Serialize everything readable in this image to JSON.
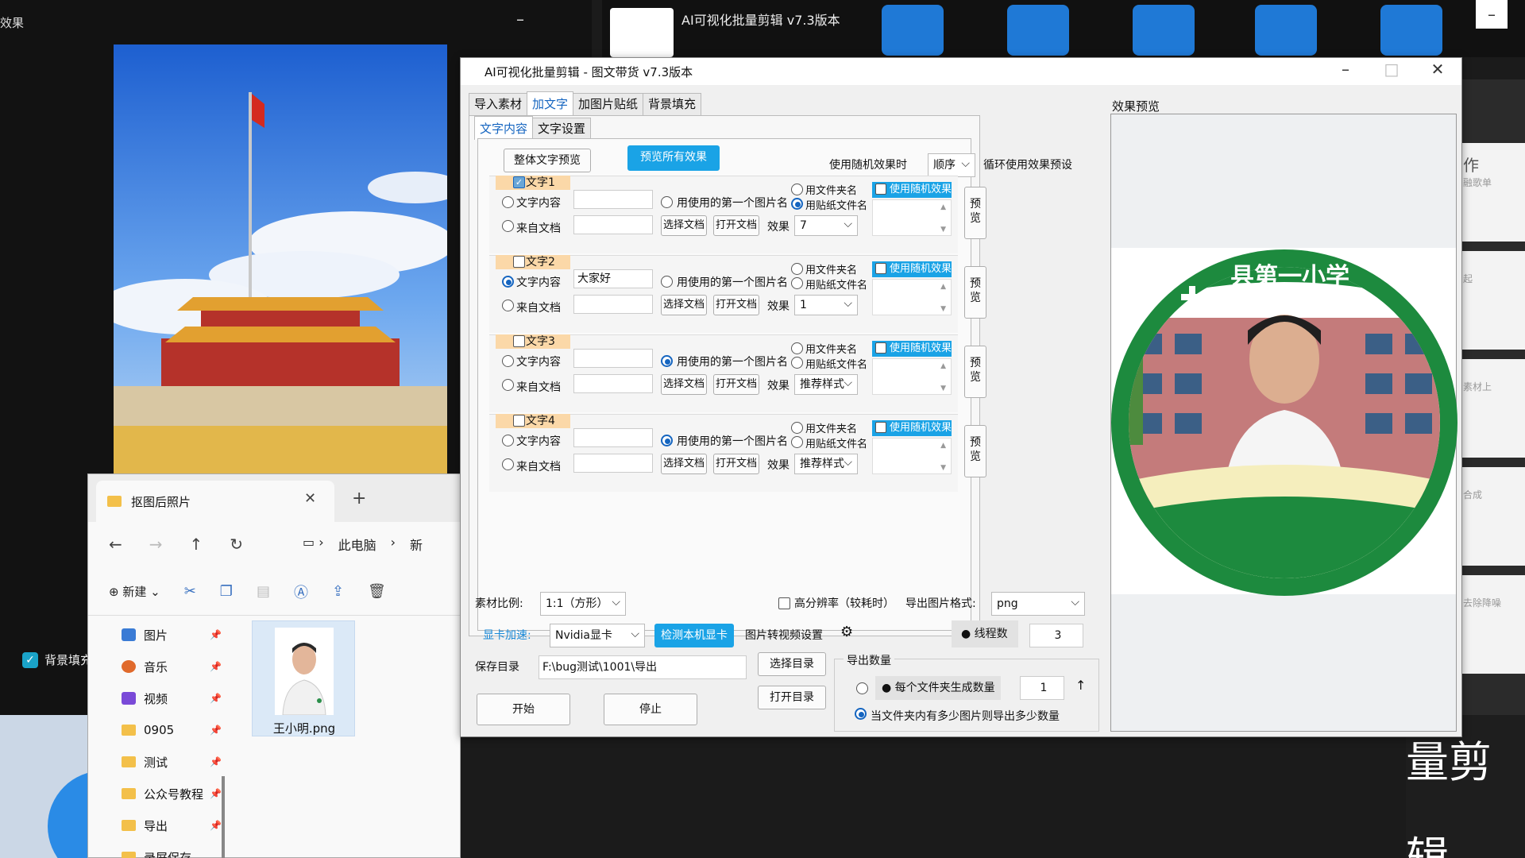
{
  "left_app": {
    "title": "效果",
    "min": "–",
    "bg_checkbox": "背景填充"
  },
  "top_app": {
    "title": "AI可视化批量剪辑 v7.3版本",
    "icon_names": [
      "video-clapper-icon",
      "add-list-icon",
      "sliders-icon",
      "export-icon",
      "grid-icon"
    ],
    "close": "–"
  },
  "right_app": {
    "cards": [
      "作",
      "融歌单",
      "起",
      "素材上",
      "合成",
      "去除降噪"
    ],
    "big_label": "量剪辑"
  },
  "explorer": {
    "tab_title": "抠图后照片",
    "close": "✕",
    "plus": "+",
    "nav": {
      "back": "←",
      "forward": "→",
      "up": "↑",
      "refresh": "↻"
    },
    "breadcrumb": [
      "此电脑",
      "新"
    ],
    "new_label": "新建",
    "sidebar": [
      {
        "label": "图片",
        "color": "#3a7bd5"
      },
      {
        "label": "音乐",
        "color": "#e06a2c"
      },
      {
        "label": "视频",
        "color": "#7a4ad8"
      },
      {
        "label": "0905",
        "color": "#f3c04a"
      },
      {
        "label": "测试",
        "color": "#f3c04a"
      },
      {
        "label": "公众号教程",
        "color": "#f3c04a"
      },
      {
        "label": "导出",
        "color": "#f3c04a"
      },
      {
        "label": "录屏保存",
        "color": "#f3c04a"
      }
    ],
    "file_name": "王小明.png"
  },
  "dialog": {
    "title": "AI可视化批量剪辑 - 图文带货 v7.3版本",
    "controls": {
      "minimize": "–",
      "maximize": "□",
      "close": "✕"
    },
    "main_tabs": [
      "导入素材",
      "加文字",
      "加图片贴纸",
      "背景填充"
    ],
    "sub_tabs": [
      "文字内容",
      "文字设置"
    ],
    "whole_preview": "整体文字预览",
    "preview_all": "预览所有效果",
    "random_mode_label": "使用随机效果时",
    "random_mode_value": "顺序",
    "loop_label": "循环使用效果预设",
    "groups": [
      {
        "title": "加文字1",
        "checked": true,
        "text_value": "",
        "src": "none",
        "name_mode": "sticker",
        "effect": "7"
      },
      {
        "title": "加文字2",
        "checked": false,
        "text_value": "大家好",
        "src": "text",
        "name_mode": "none",
        "effect": "1"
      },
      {
        "title": "加文字3",
        "checked": false,
        "text_value": "",
        "src": "first",
        "name_mode": "none",
        "effect": "推荐样式"
      },
      {
        "title": "加文字4",
        "checked": false,
        "text_value": "",
        "src": "first",
        "name_mode": "none",
        "effect": "推荐样式"
      }
    ],
    "labels": {
      "text_content": "文字内容",
      "from_doc": "来自文档",
      "first_image_name": "用使用的第一个图片名",
      "folder_name": "用文件夹名",
      "sticker_name": "用贴纸文件名",
      "choose_doc": "选择文档",
      "open_doc": "打开文档",
      "effect": "效果",
      "use_random": "使用随机效果",
      "preview": "预览"
    },
    "bottom": {
      "ratio_label": "素材比例:",
      "ratio_value": "1:1（方形）",
      "hires_label": "高分辨率（较耗时）",
      "format_label": "导出图片格式:",
      "format_value": "png",
      "gpu_label": "显卡加速:",
      "gpu_value": "Nvidia显卡",
      "detect_gpu": "检测本机显卡",
      "img2video": "图片转视频设置",
      "threads_label": "线程数",
      "threads_value": "3",
      "save_label": "保存目录",
      "save_path": "F:\\bug测试\\1001\\导出",
      "choose_dir": "选择目录",
      "open_dir": "打开目录",
      "start": "开始",
      "stop": "停止",
      "export_count_label": "导出数量",
      "per_folder_label": "每个文件夹生成数量",
      "per_folder_value": "1",
      "as_many_label": "当文件夹内有多少图片则导出多少数量"
    },
    "preview_label": "效果预览",
    "badge_text": "县第一小学",
    "colors": {
      "accent": "#1aa3e6",
      "group_header": "#fbd8a8",
      "badge_green": "#1d8a3e"
    }
  }
}
